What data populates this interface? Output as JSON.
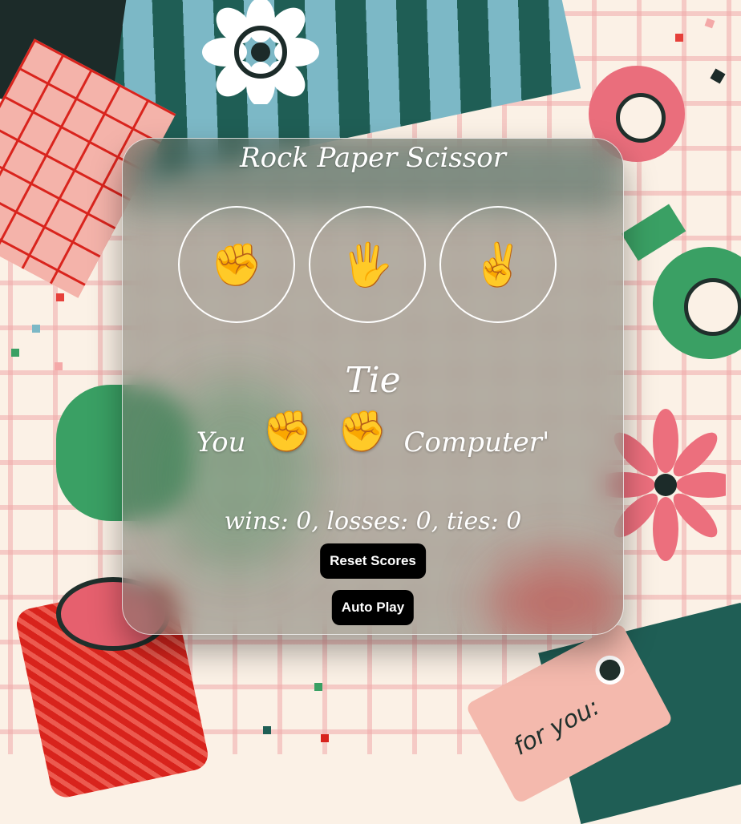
{
  "title": "Rock Paper Scissor",
  "moves": [
    {
      "name": "rock",
      "emoji": "✊"
    },
    {
      "name": "paper",
      "emoji": "🖐"
    },
    {
      "name": "scissors",
      "emoji": "✌"
    }
  ],
  "result": "Tie",
  "last_round": {
    "you_label": "You",
    "player_emoji": "✊",
    "computer_emoji": "✊",
    "computer_label": "Computer'"
  },
  "score_text": "wins: 0, losses: 0, ties: 0",
  "buttons": {
    "reset": "Reset Scores",
    "auto_play": "Auto Play"
  },
  "background": {
    "tag_text": "for you:"
  }
}
